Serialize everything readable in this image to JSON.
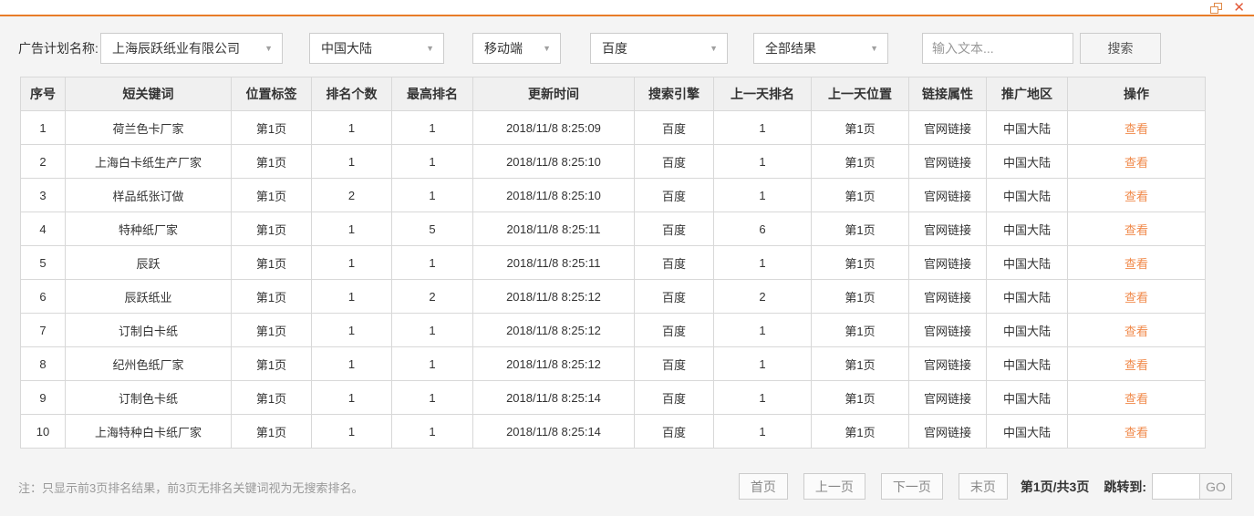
{
  "colors": {
    "accent": "#e87c28",
    "link": "#f08a4b",
    "close_icon": "#e25a3a"
  },
  "window": {
    "restore_icon": "restore-window",
    "close_icon": "close-window"
  },
  "filters": {
    "label": "广告计划名称:",
    "dropdowns": [
      {
        "name": "campaign",
        "value": "上海辰跃纸业有限公司"
      },
      {
        "name": "region",
        "value": "中国大陆"
      },
      {
        "name": "device",
        "value": "移动端"
      },
      {
        "name": "engine",
        "value": "百度"
      },
      {
        "name": "result-type",
        "value": "全部结果"
      }
    ],
    "search_input": {
      "value": "",
      "placeholder": "输入文本..."
    },
    "search_button": "搜索"
  },
  "table": {
    "columns": [
      "序号",
      "短关键词",
      "位置标签",
      "排名个数",
      "最高排名",
      "更新时间",
      "搜索引擎",
      "上一天排名",
      "上一天位置",
      "链接属性",
      "推广地区",
      "操作"
    ],
    "action_label": "查看",
    "rows": [
      [
        "1",
        "荷兰色卡厂家",
        "第1页",
        "1",
        "1",
        "2018/11/8 8:25:09",
        "百度",
        "1",
        "第1页",
        "官网链接",
        "中国大陆"
      ],
      [
        "2",
        "上海白卡纸生产厂家",
        "第1页",
        "1",
        "1",
        "2018/11/8 8:25:10",
        "百度",
        "1",
        "第1页",
        "官网链接",
        "中国大陆"
      ],
      [
        "3",
        "样品纸张订做",
        "第1页",
        "2",
        "1",
        "2018/11/8 8:25:10",
        "百度",
        "1",
        "第1页",
        "官网链接",
        "中国大陆"
      ],
      [
        "4",
        "特种纸厂家",
        "第1页",
        "1",
        "5",
        "2018/11/8 8:25:11",
        "百度",
        "6",
        "第1页",
        "官网链接",
        "中国大陆"
      ],
      [
        "5",
        "辰跃",
        "第1页",
        "1",
        "1",
        "2018/11/8 8:25:11",
        "百度",
        "1",
        "第1页",
        "官网链接",
        "中国大陆"
      ],
      [
        "6",
        "辰跃纸业",
        "第1页",
        "1",
        "2",
        "2018/11/8 8:25:12",
        "百度",
        "2",
        "第1页",
        "官网链接",
        "中国大陆"
      ],
      [
        "7",
        "订制白卡纸",
        "第1页",
        "1",
        "1",
        "2018/11/8 8:25:12",
        "百度",
        "1",
        "第1页",
        "官网链接",
        "中国大陆"
      ],
      [
        "8",
        "纪州色纸厂家",
        "第1页",
        "1",
        "1",
        "2018/11/8 8:25:12",
        "百度",
        "1",
        "第1页",
        "官网链接",
        "中国大陆"
      ],
      [
        "9",
        "订制色卡纸",
        "第1页",
        "1",
        "1",
        "2018/11/8 8:25:14",
        "百度",
        "1",
        "第1页",
        "官网链接",
        "中国大陆"
      ],
      [
        "10",
        "上海特种白卡纸厂家",
        "第1页",
        "1",
        "1",
        "2018/11/8 8:25:14",
        "百度",
        "1",
        "第1页",
        "官网链接",
        "中国大陆"
      ]
    ]
  },
  "footer": {
    "note": "注：只显示前3页排名结果，前3页无排名关键词视为无搜索排名。",
    "pagination": {
      "first": "首页",
      "prev": "上一页",
      "next": "下一页",
      "last": "末页",
      "page_info": "第1页/共3页",
      "jump_label": "跳转到:",
      "jump_value": "",
      "go": "GO"
    }
  }
}
